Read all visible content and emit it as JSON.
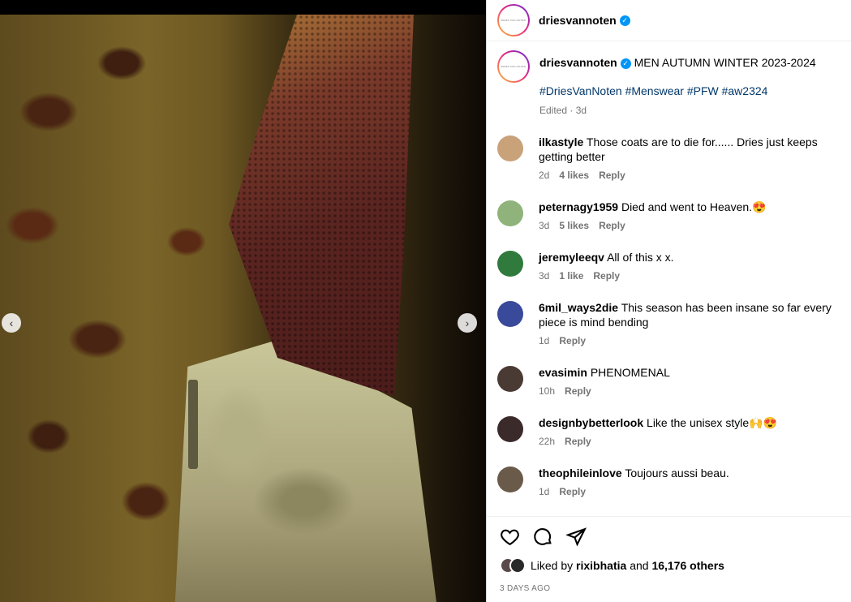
{
  "post": {
    "username": "driesvannoten",
    "verified_mark": "✓",
    "caption": "MEN AUTUMN WINTER 2023-2024",
    "hashtags": "#DriesVanNoten #Menswear #PFW #aw2324",
    "edited": "Edited · 3d",
    "avatar_text": "DRIES VAN NOTEN"
  },
  "comments": [
    {
      "user": "ilkastyle",
      "text": "Those coats are to die for...... Dries just keeps getting better",
      "time": "2d",
      "likes": "4 likes",
      "reply": "Reply",
      "avatar_color": "#c9a27a"
    },
    {
      "user": "peternagy1959",
      "text": "Died and went to Heaven.😍",
      "time": "3d",
      "likes": "5 likes",
      "reply": "Reply",
      "avatar_color": "#8fb37a"
    },
    {
      "user": "jeremyleeqv",
      "text": "All of this x x.",
      "time": "3d",
      "likes": "1 like",
      "reply": "Reply",
      "avatar_color": "#2f7a3c"
    },
    {
      "user": "6mil_ways2die",
      "text": "This season has been insane so far every piece is mind bending",
      "time": "1d",
      "likes": "",
      "reply": "Reply",
      "avatar_color": "#3a4a9a"
    },
    {
      "user": "evasimin",
      "text": "PHENOMENAL",
      "time": "10h",
      "likes": "",
      "reply": "Reply",
      "avatar_color": "#4a3a34"
    },
    {
      "user": "designbybetterlook",
      "text": "Like the unisex style🙌😍",
      "time": "22h",
      "likes": "",
      "reply": "Reply",
      "avatar_color": "#3a2a2a"
    },
    {
      "user": "theophileinlove",
      "text": "Toujours aussi beau.",
      "time": "1d",
      "likes": "",
      "reply": "Reply",
      "avatar_color": "#6a5a4a"
    }
  ],
  "footer": {
    "liked_prefix": "Liked by",
    "liked_user": "rixibhatia",
    "liked_and": "and",
    "liked_others": "16,176 others",
    "date": "3 DAYS AGO"
  },
  "icons": {
    "prev": "chevron-left-icon",
    "next": "chevron-right-icon",
    "like": "heart-icon",
    "comment": "comment-icon",
    "share": "share-icon"
  },
  "nav": {
    "prev_glyph": "‹",
    "next_glyph": "›"
  }
}
